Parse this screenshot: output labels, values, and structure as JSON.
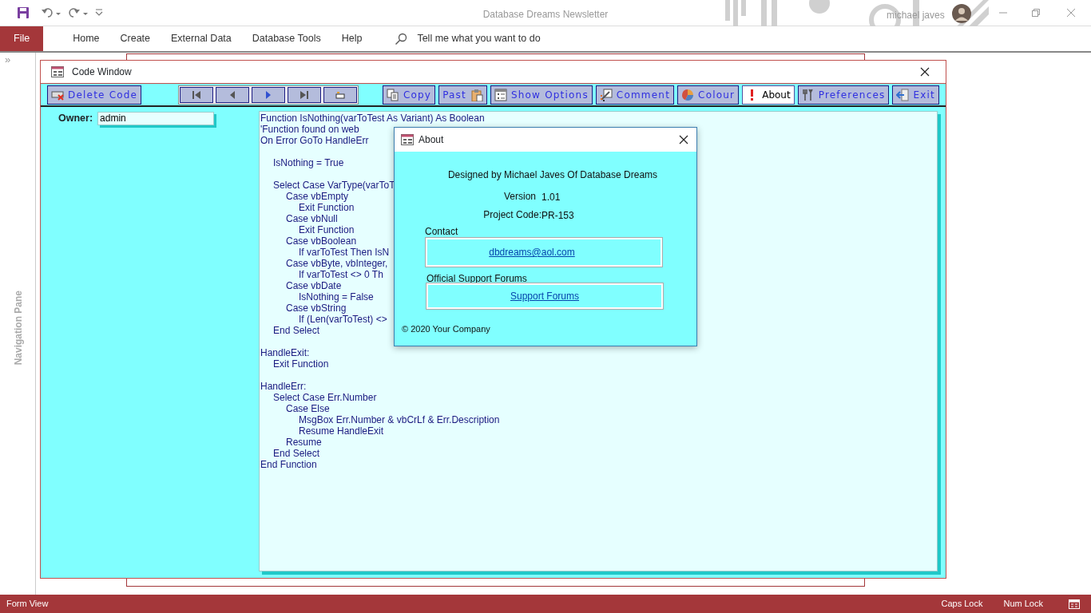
{
  "app": {
    "title": "Database Dreams Newsletter",
    "user": "michael javes"
  },
  "ribbon_tabs": [
    {
      "label": "File",
      "selected": true
    },
    {
      "label": "Home",
      "selected": false
    },
    {
      "label": "Create",
      "selected": false
    },
    {
      "label": "External Data",
      "selected": false
    },
    {
      "label": "Database Tools",
      "selected": false
    },
    {
      "label": "Help",
      "selected": false
    }
  ],
  "tell_me": {
    "placeholder": "Tell me what you want to do"
  },
  "navigation_pane": {
    "toggle": "»",
    "label": "Navigation Pane"
  },
  "code_window": {
    "title": "Code Window",
    "toolbar": [
      {
        "label": "Delete Code",
        "selected": false
      },
      {
        "label": "Copy",
        "selected": false
      },
      {
        "label": "Past",
        "selected": false
      },
      {
        "label": "Show Options",
        "selected": false
      },
      {
        "label": "Comment",
        "selected": false
      },
      {
        "label": "Colour",
        "selected": false
      },
      {
        "label": "About",
        "selected": true
      },
      {
        "label": "Preferences",
        "selected": false
      },
      {
        "label": "Exit",
        "selected": false
      }
    ],
    "owner": {
      "label": "Owner:",
      "value": "admin"
    },
    "code": [
      {
        "text": "Function IsNothing(varToTest As Variant) As Boolean"
      },
      {
        "text": "'Function found on web"
      },
      {
        "text": "On Error GoTo HandleErr",
        "children": [
          {
            "text": "IsNothing = True",
            "blank_before": true
          },
          {
            "text": "Select Case VarType(varToT",
            "blank_before": true,
            "children": [
              {
                "text": "Case vbEmpty",
                "children": [
                  {
                    "text": "Exit Function"
                  }
                ]
              },
              {
                "text": "Case vbNull",
                "children": [
                  {
                    "text": "Exit Function"
                  }
                ]
              },
              {
                "text": "Case vbBoolean",
                "children": [
                  {
                    "text": "If varToTest Then IsN"
                  }
                ]
              },
              {
                "text": "Case vbByte, vbInteger,",
                "children": [
                  {
                    "text": "If varToTest <> 0 Th"
                  }
                ]
              },
              {
                "text": "Case vbDate",
                "children": [
                  {
                    "text": "IsNothing = False"
                  }
                ]
              },
              {
                "text": "Case vbString",
                "children": [
                  {
                    "text": "If (Len(varToTest) <>"
                  }
                ]
              }
            ]
          },
          {
            "text": "End Select"
          }
        ]
      },
      {
        "text": "HandleExit:",
        "blank_before": true,
        "children": [
          {
            "text": "Exit Function"
          }
        ]
      },
      {
        "text": "HandleErr:",
        "blank_before": true,
        "children": [
          {
            "text": "Select Case Err.Number",
            "children": [
              {
                "text": "Case Else",
                "children": [
                  {
                    "text": "MsgBox Err.Number & vbCrLf & Err.Description"
                  },
                  {
                    "text": "Resume HandleExit"
                  }
                ]
              },
              {
                "text": "Resume"
              }
            ]
          },
          {
            "text": "End Select"
          }
        ]
      },
      {
        "text": "End Function"
      }
    ]
  },
  "about_dialog": {
    "title": "About",
    "designed": "Designed by Michael Javes Of Database Dreams",
    "version_label": "Version",
    "version": "1.01",
    "project_label": "Project Code:",
    "project_code": "PR-153",
    "contact_label": "Contact",
    "email": "dbdreams@aol.com",
    "forums_label": "Official Support Forums",
    "forums_link": "Support Forums",
    "copyright": "© 2020 Your Company"
  },
  "status_bar": {
    "mode": "Form View",
    "indicators": [
      "Caps Lock",
      "Num Lock"
    ]
  }
}
